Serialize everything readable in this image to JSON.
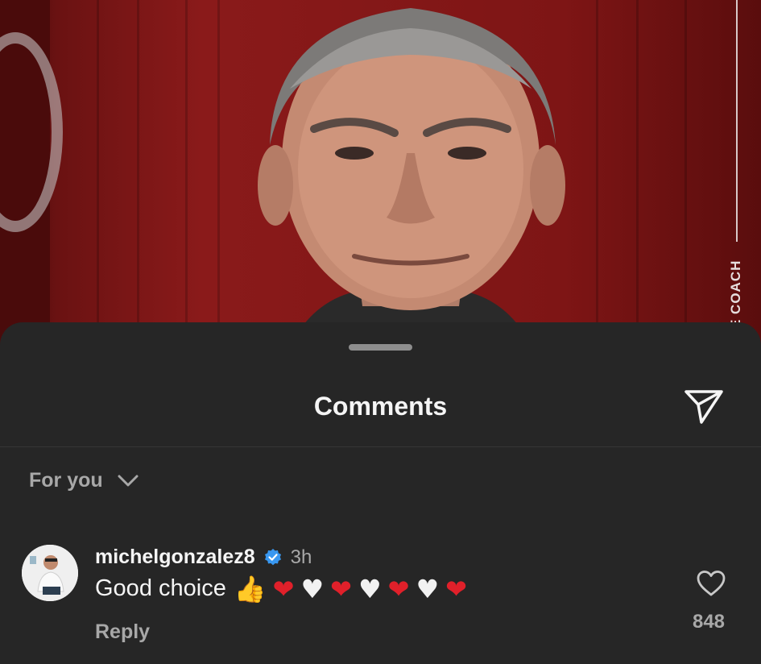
{
  "post": {
    "side_text": "E COACH"
  },
  "sheet": {
    "title": "Comments",
    "filter_label": "For you"
  },
  "comment": {
    "username": "michelgonzalez8",
    "time": "3h",
    "text": "Good choice",
    "emojis": [
      "👍",
      "❤",
      "♥",
      "❤",
      "♥",
      "❤",
      "♥",
      "❤"
    ],
    "reply_label": "Reply",
    "like_count": "848"
  },
  "icons": {
    "share": "paper-plane-icon",
    "filter": "chevron-down-icon",
    "verified": "verified-badge-icon",
    "like": "heart-outline-icon"
  },
  "colors": {
    "sheet_bg": "#262626",
    "verified_blue": "#3897f0",
    "heart_red": "#e0202a",
    "secondary_text": "#a8a8a8"
  }
}
